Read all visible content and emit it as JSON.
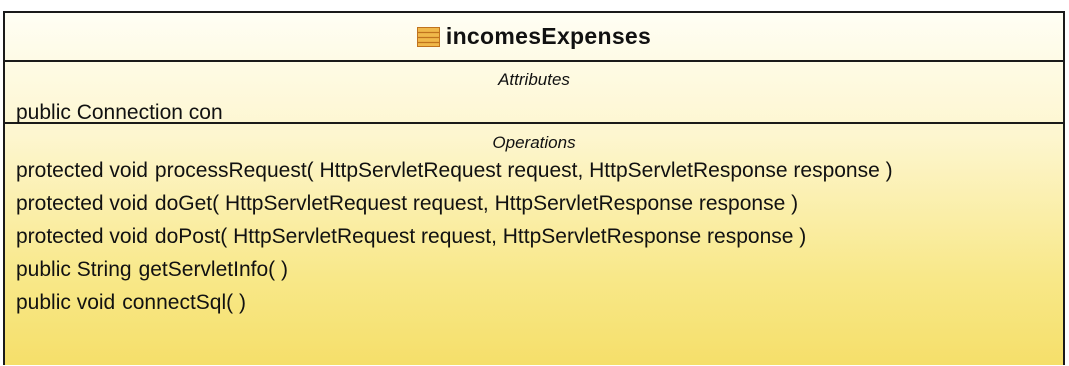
{
  "class": {
    "name": "incomesExpenses",
    "icon": "class-icon"
  },
  "attributes": {
    "label": "Attributes",
    "items": [
      "public Connection con"
    ]
  },
  "operations": {
    "label": "Operations",
    "items": [
      {
        "prefix": "protected void",
        "signature": "processRequest( HttpServletRequest request, HttpServletResponse response )"
      },
      {
        "prefix": "protected void",
        "signature": "doGet( HttpServletRequest request, HttpServletResponse response )"
      },
      {
        "prefix": "protected void",
        "signature": "doPost( HttpServletRequest request, HttpServletResponse response )"
      },
      {
        "prefix": "public String",
        "signature": "getServletInfo( )"
      },
      {
        "prefix": "public void",
        "signature": "connectSql( )"
      }
    ]
  },
  "colors": {
    "border": "#1a1a1a",
    "fill_top": "#fffef4",
    "fill_bottom": "#f5df6a",
    "icon_fill": "#f0b84a",
    "icon_stroke": "#c0731e"
  }
}
